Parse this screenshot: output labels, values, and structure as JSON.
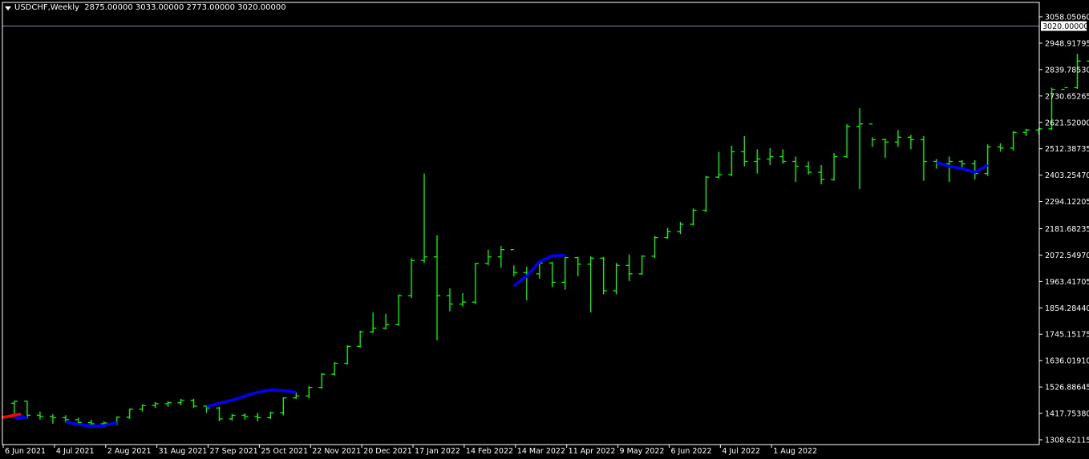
{
  "header": {
    "symbol_timeframe": "USDCHF,Weekly",
    "ohlc": "2875.00000 3033.00000 2773.00000 3020.00000"
  },
  "colors": {
    "background": "#000000",
    "bar": "#00ff00",
    "axis": "#ffffff",
    "price_line": "#7f8ea8",
    "ma_up": "#0000ff",
    "ma_down": "#ff0000"
  },
  "chart_data": {
    "type": "ohlc",
    "title": "",
    "current_price": 3020.0,
    "current_price_label": "3020.00000",
    "ylim": [
      1308.62115,
      3075
    ],
    "y_ticks": [
      {
        "value": 3058.0506,
        "label": "3058.05060"
      },
      {
        "value": 2948.91795,
        "label": "2948.91795"
      },
      {
        "value": 2839.7853,
        "label": "2839.78530"
      },
      {
        "value": 2730.65265,
        "label": "2730.65265"
      },
      {
        "value": 2621.52,
        "label": "2621.52000"
      },
      {
        "value": 2512.38735,
        "label": "2512.38735"
      },
      {
        "value": 2403.2547,
        "label": "2403.25470"
      },
      {
        "value": 2294.12205,
        "label": "2294.12205"
      },
      {
        "value": 2181.68235,
        "label": "2181.68235"
      },
      {
        "value": 2072.5497,
        "label": "2072.54970"
      },
      {
        "value": 1963.41705,
        "label": "1963.41705"
      },
      {
        "value": 1854.2844,
        "label": "1854.28440"
      },
      {
        "value": 1745.15175,
        "label": "1745.15175"
      },
      {
        "value": 1636.0191,
        "label": "1636.01910"
      },
      {
        "value": 1526.88645,
        "label": "1526.88645"
      },
      {
        "value": 1417.7538,
        "label": "1417.75380"
      },
      {
        "value": 1308.62115,
        "label": "1308.62115"
      }
    ],
    "x_ticks": [
      {
        "index": 0,
        "label": "6 Jun 2021"
      },
      {
        "index": 4,
        "label": "4 Jul 2021"
      },
      {
        "index": 8,
        "label": "2 Aug 2021"
      },
      {
        "index": 12,
        "label": "31 Aug 2021"
      },
      {
        "index": 16,
        "label": "27 Sep 2021"
      },
      {
        "index": 20,
        "label": "25 Oct 2021"
      },
      {
        "index": 24,
        "label": "22 Nov 2021"
      },
      {
        "index": 28,
        "label": "20 Dec 2021"
      },
      {
        "index": 32,
        "label": "17 Jan 2022"
      },
      {
        "index": 36,
        "label": "14 Feb 2022"
      },
      {
        "index": 40,
        "label": "14 Mar 2022"
      },
      {
        "index": 44,
        "label": "11 Apr 2022"
      },
      {
        "index": 48,
        "label": "9 May 2022"
      },
      {
        "index": 52,
        "label": "6 Jun 2022"
      },
      {
        "index": 56,
        "label": "4 Jul 2022"
      },
      {
        "index": 60,
        "label": "1 Aug 2022"
      }
    ],
    "bars": [
      [
        1460,
        1470,
        1415,
        1468
      ],
      [
        1468,
        1470,
        1395,
        1410
      ],
      [
        1410,
        1425,
        1392,
        1405
      ],
      [
        1405,
        1415,
        1375,
        1400
      ],
      [
        1400,
        1410,
        1380,
        1392
      ],
      [
        1392,
        1400,
        1372,
        1380
      ],
      [
        1380,
        1392,
        1365,
        1375
      ],
      [
        1375,
        1385,
        1360,
        1378
      ],
      [
        1378,
        1405,
        1370,
        1402
      ],
      [
        1402,
        1438,
        1395,
        1435
      ],
      [
        1435,
        1455,
        1425,
        1450
      ],
      [
        1450,
        1465,
        1440,
        1458
      ],
      [
        1458,
        1468,
        1445,
        1462
      ],
      [
        1462,
        1478,
        1452,
        1472
      ],
      [
        1472,
        1478,
        1440,
        1448
      ],
      [
        1448,
        1452,
        1420,
        1440
      ],
      [
        1440,
        1445,
        1385,
        1395
      ],
      [
        1395,
        1415,
        1388,
        1410
      ],
      [
        1410,
        1418,
        1392,
        1405
      ],
      [
        1405,
        1420,
        1385,
        1400
      ],
      [
        1400,
        1425,
        1395,
        1420
      ],
      [
        1420,
        1485,
        1410,
        1482
      ],
      [
        1482,
        1505,
        1478,
        1490
      ],
      [
        1490,
        1530,
        1480,
        1525
      ],
      [
        1525,
        1585,
        1520,
        1580
      ],
      [
        1580,
        1630,
        1575,
        1625
      ],
      [
        1625,
        1700,
        1620,
        1695
      ],
      [
        1695,
        1760,
        1690,
        1755
      ],
      [
        1755,
        1835,
        1750,
        1770
      ],
      [
        1770,
        1830,
        1765,
        1785
      ],
      [
        1785,
        1910,
        1780,
        1905
      ],
      [
        1905,
        2060,
        1895,
        2050
      ],
      [
        2050,
        2410,
        2040,
        2065
      ],
      [
        2065,
        2155,
        1720,
        1905
      ],
      [
        1905,
        1935,
        1840,
        1870
      ],
      [
        1870,
        1915,
        1860,
        1878
      ],
      [
        1878,
        2040,
        1870,
        2038
      ],
      [
        2038,
        2095,
        2030,
        2065
      ],
      [
        2065,
        2110,
        2020,
        2095
      ],
      [
        2095,
        2030,
        1985,
        2000
      ],
      [
        2000,
        2025,
        1885,
        1995
      ],
      [
        1995,
        2050,
        1975,
        2040
      ],
      [
        2040,
        2045,
        1940,
        1960
      ],
      [
        1960,
        2065,
        1930,
        2062
      ],
      [
        2062,
        2065,
        1985,
        2035
      ],
      [
        2035,
        2068,
        1835,
        2060
      ],
      [
        2060,
        2065,
        1910,
        1925
      ],
      [
        1925,
        2040,
        1910,
        2030
      ],
      [
        2030,
        2075,
        1965,
        1995
      ],
      [
        1995,
        2072,
        1990,
        2068
      ],
      [
        2068,
        2152,
        2060,
        2145
      ],
      [
        2145,
        2185,
        2140,
        2170
      ],
      [
        2170,
        2210,
        2160,
        2200
      ],
      [
        2200,
        2265,
        2195,
        2258
      ],
      [
        2258,
        2400,
        2250,
        2395
      ],
      [
        2395,
        2500,
        2390,
        2405
      ],
      [
        2405,
        2525,
        2400,
        2500
      ],
      [
        2500,
        2565,
        2440,
        2460
      ],
      [
        2460,
        2510,
        2410,
        2470
      ],
      [
        2470,
        2515,
        2445,
        2480
      ],
      [
        2480,
        2510,
        2450,
        2460
      ],
      [
        2460,
        2480,
        2375,
        2440
      ],
      [
        2440,
        2460,
        2405,
        2415
      ],
      [
        2415,
        2445,
        2365,
        2385
      ],
      [
        2385,
        2495,
        2380,
        2480
      ],
      [
        2480,
        2615,
        2475,
        2605
      ],
      [
        2605,
        2680,
        2345,
        2615
      ],
      [
        2615,
        2560,
        2520,
        2550
      ],
      [
        2550,
        2555,
        2475,
        2540
      ],
      [
        2540,
        2590,
        2520,
        2560
      ],
      [
        2560,
        2570,
        2510,
        2550
      ],
      [
        2550,
        2565,
        2380,
        2460
      ],
      [
        2460,
        2470,
        2430,
        2450
      ],
      [
        2450,
        2480,
        2375,
        2460
      ],
      [
        2460,
        2465,
        2430,
        2450
      ],
      [
        2450,
        2465,
        2385,
        2410
      ],
      [
        2410,
        2530,
        2400,
        2520
      ],
      [
        2520,
        2535,
        2500,
        2515
      ],
      [
        2515,
        2585,
        2505,
        2580
      ],
      [
        2580,
        2595,
        2565,
        2590
      ],
      [
        2590,
        2600,
        2570,
        2595
      ],
      [
        2595,
        2765,
        2590,
        2758
      ],
      [
        2758,
        2765,
        2765,
        2765
      ],
      [
        2765,
        2905,
        2760,
        2875
      ],
      [
        2875,
        3033,
        2773,
        3020
      ]
    ],
    "ma_segments": [
      {
        "color": "up",
        "points": [
          [
            0,
            1398
          ],
          [
            1,
            1402
          ]
        ]
      },
      {
        "color": "down",
        "points": [
          [
            -1,
            1400
          ],
          [
            0.5,
            1415
          ]
        ]
      },
      {
        "color": "up",
        "points": [
          [
            4,
            1382
          ],
          [
            5,
            1372
          ],
          [
            6,
            1365
          ],
          [
            7,
            1368
          ],
          [
            8,
            1380
          ]
        ]
      },
      {
        "color": "up",
        "points": [
          [
            15,
            1445
          ],
          [
            16,
            1460
          ],
          [
            17,
            1472
          ],
          [
            18,
            1490
          ],
          [
            19,
            1505
          ],
          [
            20,
            1515
          ],
          [
            21,
            1512
          ],
          [
            22,
            1505
          ]
        ]
      },
      {
        "color": "up",
        "points": [
          [
            39,
            1945
          ],
          [
            40,
            1985
          ],
          [
            41,
            2045
          ],
          [
            42,
            2070
          ],
          [
            43,
            2072
          ]
        ]
      },
      {
        "color": "up",
        "points": [
          [
            72,
            2455
          ],
          [
            73,
            2440
          ],
          [
            74,
            2430
          ],
          [
            75,
            2415
          ],
          [
            76,
            2445
          ]
        ]
      }
    ]
  }
}
